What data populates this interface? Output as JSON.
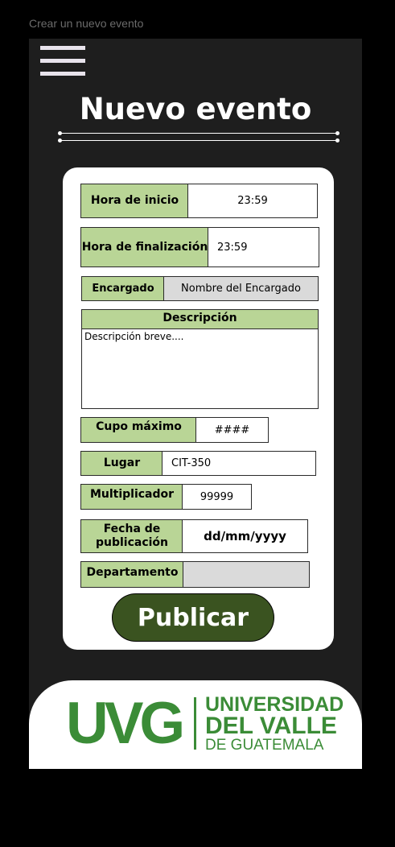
{
  "frame": {
    "label": "Crear un nuevo evento"
  },
  "header": {
    "title": "Nuevo evento"
  },
  "form": {
    "start_time": {
      "label": "Hora de inicio",
      "value": "23:59"
    },
    "end_time": {
      "label": "Hora de finalización",
      "value": "23:59"
    },
    "manager": {
      "label": "Encargado",
      "placeholder": "Nombre del Encargado"
    },
    "description": {
      "label": "Descripción",
      "placeholder": "Descripción breve...."
    },
    "max_capacity": {
      "label": "Cupo máximo",
      "placeholder": "####"
    },
    "place": {
      "label": "Lugar",
      "value": "CIT-350"
    },
    "multiplier": {
      "label": "Multiplicador",
      "value": "99999"
    },
    "publish_date": {
      "label_line1": "Fecha de",
      "label_line2": "publicación",
      "placeholder": "dd/mm/yyyy"
    },
    "department": {
      "label": "Departamento",
      "value": ""
    },
    "publish_button": "Publicar"
  },
  "footer": {
    "logo_short": "UVG",
    "logo_line1": "UNIVERSIDAD",
    "logo_line2": "DEL VALLE",
    "logo_line3": "DE GUATEMALA"
  },
  "colors": {
    "label_green": "#b9d596",
    "button_green": "#3a5320",
    "brand_green": "#3b8c37",
    "background": "#1e1e1e"
  }
}
